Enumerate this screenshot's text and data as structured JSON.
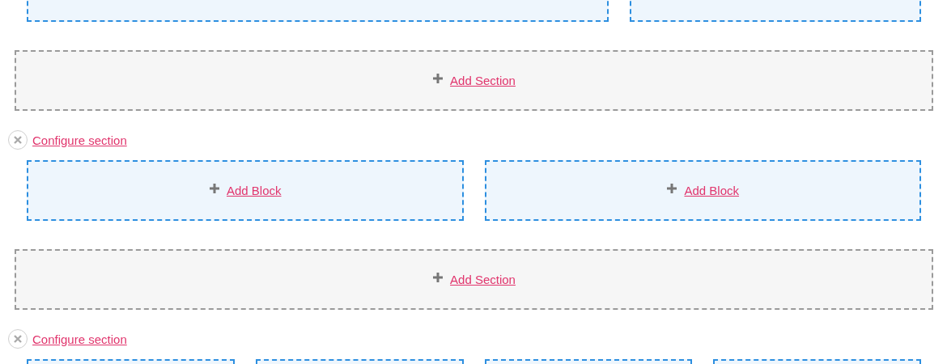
{
  "rows": [
    {
      "kind": "regions",
      "columns": [
        {
          "kind": "wide"
        },
        {
          "kind": "narrow"
        }
      ]
    },
    {
      "kind": "add_section",
      "link": "Add Section"
    },
    {
      "kind": "configure",
      "link": "Configure section"
    },
    {
      "kind": "regions",
      "columns": [
        {
          "kind": "half",
          "link": "Add Block"
        },
        {
          "kind": "half",
          "link": "Add Block"
        }
      ]
    },
    {
      "kind": "add_section",
      "link": "Add Section"
    },
    {
      "kind": "configure",
      "link": "Configure section"
    },
    {
      "kind": "regions",
      "columns": [
        {
          "kind": "quarter"
        },
        {
          "kind": "quarter"
        },
        {
          "kind": "quarter"
        },
        {
          "kind": "quarter"
        }
      ]
    }
  ]
}
